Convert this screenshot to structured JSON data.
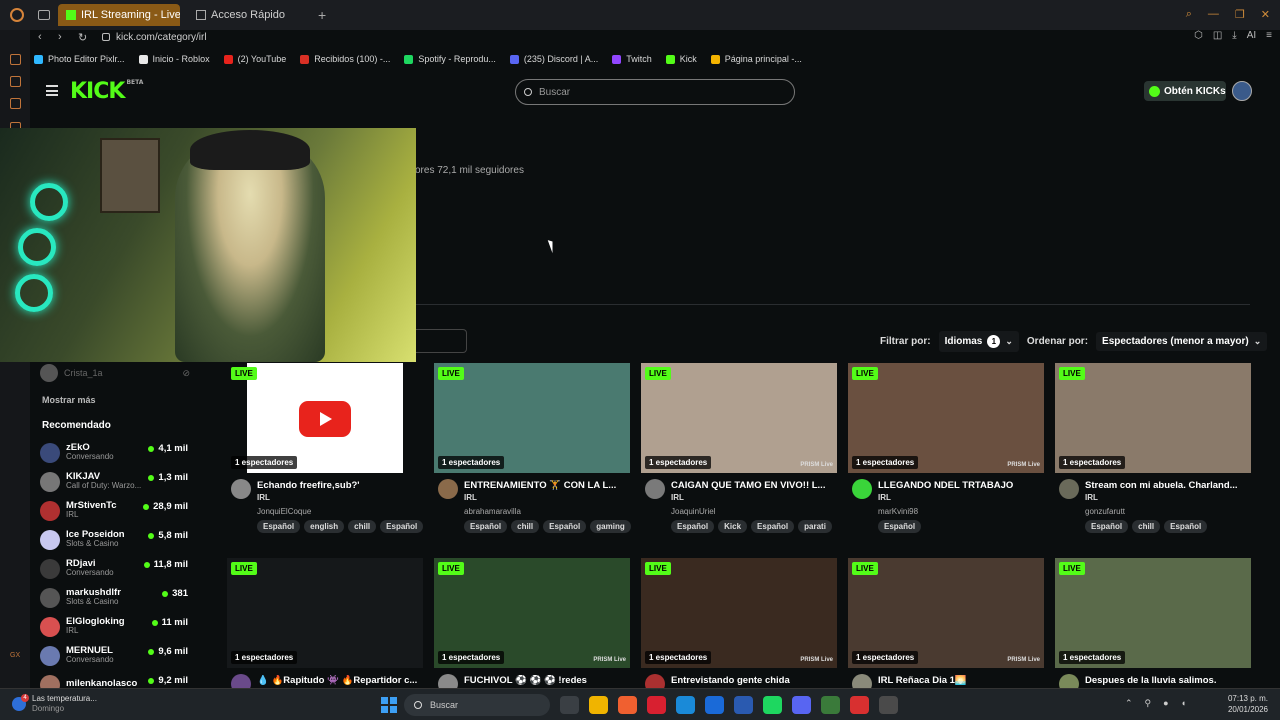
{
  "browser": {
    "tabs": [
      {
        "label": "IRL Streaming - Live Strea",
        "active": true
      },
      {
        "label": "Acceso Rápido",
        "active": false
      }
    ],
    "url": "kick.com/category/irl",
    "ai_label": "AI",
    "bookmarks": [
      {
        "label": "Photo Editor Pixlr...",
        "color": "#2fb8ff"
      },
      {
        "label": "Inicio - Roblox",
        "color": "#e8e8e8"
      },
      {
        "label": "(2) YouTube",
        "color": "#e8231c"
      },
      {
        "label": "Recibidos (100) -...",
        "color": "#d93025"
      },
      {
        "label": "Spotify - Reprodu...",
        "color": "#1ed760"
      },
      {
        "label": "(235) Discord | A...",
        "color": "#5865f2"
      },
      {
        "label": "Twitch",
        "color": "#9146ff"
      },
      {
        "label": "Kick",
        "color": "#53fc18"
      },
      {
        "label": "Página principal -...",
        "color": "#f4b400"
      }
    ]
  },
  "kick": {
    "logo": "KICK",
    "logo_tag": "BETA",
    "search_placeholder": "Buscar",
    "kicks_button": "Obtén KICKs"
  },
  "category": {
    "followers_text": "ores  72,1 mil seguidores"
  },
  "filters": {
    "filter_label": "Filtrar por:",
    "languages_label": "Idiomas",
    "languages_count": "1",
    "sort_label": "Ordenar por:",
    "sort_value": "Espectadores (menor a mayor)"
  },
  "sidebar": {
    "followed_user": "Crista_1a",
    "show_more": "Mostrar más",
    "recommended_title": "Recomendado",
    "recommended": [
      {
        "name": "zEkO",
        "category": "Conversando",
        "viewers": "4,1 mil",
        "color": "#3a4a7a"
      },
      {
        "name": "KIKJAV",
        "category": "Call of Duty: Warzo...",
        "viewers": "1,3 mil",
        "color": "#777777"
      },
      {
        "name": "MrStivenTc",
        "category": "IRL",
        "viewers": "28,9 mil",
        "color": "#b03030"
      },
      {
        "name": "Ice Poseidon",
        "category": "Slots & Casino",
        "viewers": "5,8 mil",
        "color": "#c8c8f0"
      },
      {
        "name": "RDjavi",
        "category": "Conversando",
        "viewers": "11,8 mil",
        "color": "#3a3a3a"
      },
      {
        "name": "markushdlfr",
        "category": "Slots & Casino",
        "viewers": "381",
        "color": "#555555"
      },
      {
        "name": "ElGlogloking",
        "category": "IRL",
        "viewers": "11 mil",
        "color": "#d85050"
      },
      {
        "name": "MERNUEL",
        "category": "Conversando",
        "viewers": "9,6 mil",
        "color": "#6a7ab0"
      },
      {
        "name": "milenkanolasco",
        "category": "",
        "viewers": "9,2 mil",
        "color": "#a07060"
      }
    ]
  },
  "streams": [
    {
      "title": "Echando freefire,sub?'",
      "category": "IRL",
      "user": "JonquiElCoque",
      "viewers": "1 espectadores",
      "live": "LIVE",
      "tags": [
        "Español",
        "english",
        "chill",
        "Español"
      ],
      "thumb": "#ffffff",
      "av": "#888888",
      "yt": true,
      "prism": ""
    },
    {
      "title": "ENTRENAMIENTO 🏋 CON LA L...",
      "category": "IRL",
      "user": "abrahamaravilla",
      "viewers": "1 espectadores",
      "live": "LIVE",
      "tags": [
        "Español",
        "chill",
        "Español",
        "gaming"
      ],
      "thumb": "#4a7a70",
      "av": "#8a6a4a",
      "yt": false,
      "prism": ""
    },
    {
      "title": "CAIGAN QUE TAMO EN VIVO!! L...",
      "category": "IRL",
      "user": "JoaquinUriel",
      "viewers": "1 espectadores",
      "live": "LIVE",
      "tags": [
        "Español",
        "Kick",
        "Español",
        "parati"
      ],
      "thumb": "#b0a090",
      "av": "#7a7a7a",
      "yt": false,
      "prism": "PRISM Live"
    },
    {
      "title": "LLEGANDO NDEL TRTABAJO",
      "category": "IRL",
      "user": "marKvini98",
      "viewers": "1 espectadores",
      "live": "LIVE",
      "tags": [
        "Español"
      ],
      "thumb": "#6a5040",
      "av": "#3ad43a",
      "yt": false,
      "prism": "PRISM Live"
    },
    {
      "title": "Stream con mi abuela. Charland...",
      "category": "IRL",
      "user": "gonzufarutt",
      "viewers": "1 espectadores",
      "live": "LIVE",
      "tags": [
        "Español",
        "chill",
        "Español"
      ],
      "thumb": "#8a7a6a",
      "av": "#6a6a5a",
      "yt": false,
      "prism": ""
    },
    {
      "title": "💧 🔥Rapitudo 👾 🔥Repartidor c...",
      "category": "",
      "user": "",
      "viewers": "1 espectadores",
      "live": "LIVE",
      "tags": [],
      "thumb": "#15181a",
      "av": "#6a4a8a",
      "yt": false,
      "prism": ""
    },
    {
      "title": "FUCHIVOL ⚽ ⚽ ⚽ !redes",
      "category": "",
      "user": "",
      "viewers": "1 espectadores",
      "live": "LIVE",
      "tags": [],
      "thumb": "#2a4a2a",
      "av": "#8a8a8a",
      "yt": false,
      "prism": "PRISM Live"
    },
    {
      "title": "Entrevistando gente chida",
      "category": "",
      "user": "",
      "viewers": "1 espectadores",
      "live": "LIVE",
      "tags": [],
      "thumb": "#3a2a20",
      "av": "#aa3030",
      "yt": false,
      "prism": "PRISM Live"
    },
    {
      "title": "IRL Reñaca Dia 1🌅",
      "category": "",
      "user": "",
      "viewers": "1 espectadores",
      "live": "LIVE",
      "tags": [],
      "thumb": "#4a3a30",
      "av": "#8a8a7a",
      "yt": false,
      "prism": "PRISM Live"
    },
    {
      "title": "Despues de la lluvia salimos.",
      "category": "",
      "user": "",
      "viewers": "1 espectadores",
      "live": "LIVE",
      "tags": [],
      "thumb": "#5a6a4a",
      "av": "#7a8a5a",
      "yt": false,
      "prism": ""
    }
  ],
  "taskbar": {
    "weather_title": "Las temperatura...",
    "weather_sub": "Domingo",
    "weather_badge": "4",
    "search_placeholder": "Buscar",
    "time": "07:13 p. m.",
    "date": "20/01/2026",
    "gx_label": "GX",
    "app_colors": [
      "#3a3f44",
      "#f0b400",
      "#f06030",
      "#d82030",
      "#1a8ad8",
      "#1a6ad8",
      "#2a5ab0",
      "#1ed760",
      "#5865f2",
      "#3a7a3a",
      "#d83030",
      "#4a4a4a"
    ]
  }
}
